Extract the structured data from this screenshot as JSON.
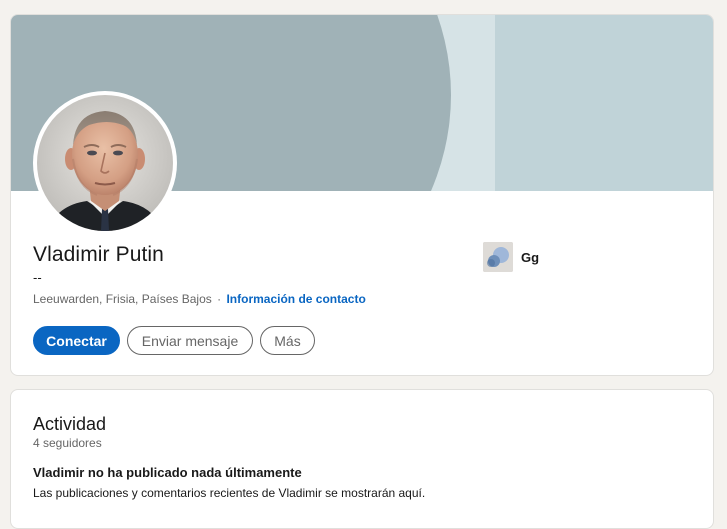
{
  "profile": {
    "name": "Vladimir Putin",
    "headline": "--",
    "location": "Leeuwarden, Frisia, Países Bajos",
    "separator": "·",
    "contact_link": "Información de contacto",
    "company": {
      "name": "Gg",
      "logo_icon": "company-logo-circles"
    },
    "actions": {
      "connect": "Conectar",
      "message": "Enviar mensaje",
      "more": "Más"
    }
  },
  "activity": {
    "title": "Actividad",
    "followers": "4 seguidores",
    "empty_title": "Vladimir no ha publicado nada últimamente",
    "empty_desc": "Las publicaciones y comentarios recientes de Vladimir se mostrarán aquí."
  },
  "colors": {
    "accent": "#0a66c2",
    "page_background": "#f4f2ee",
    "banner_dark": "#a0b2b7",
    "banner_light": "#d6e3e6",
    "banner_right": "#c0d3d8"
  }
}
